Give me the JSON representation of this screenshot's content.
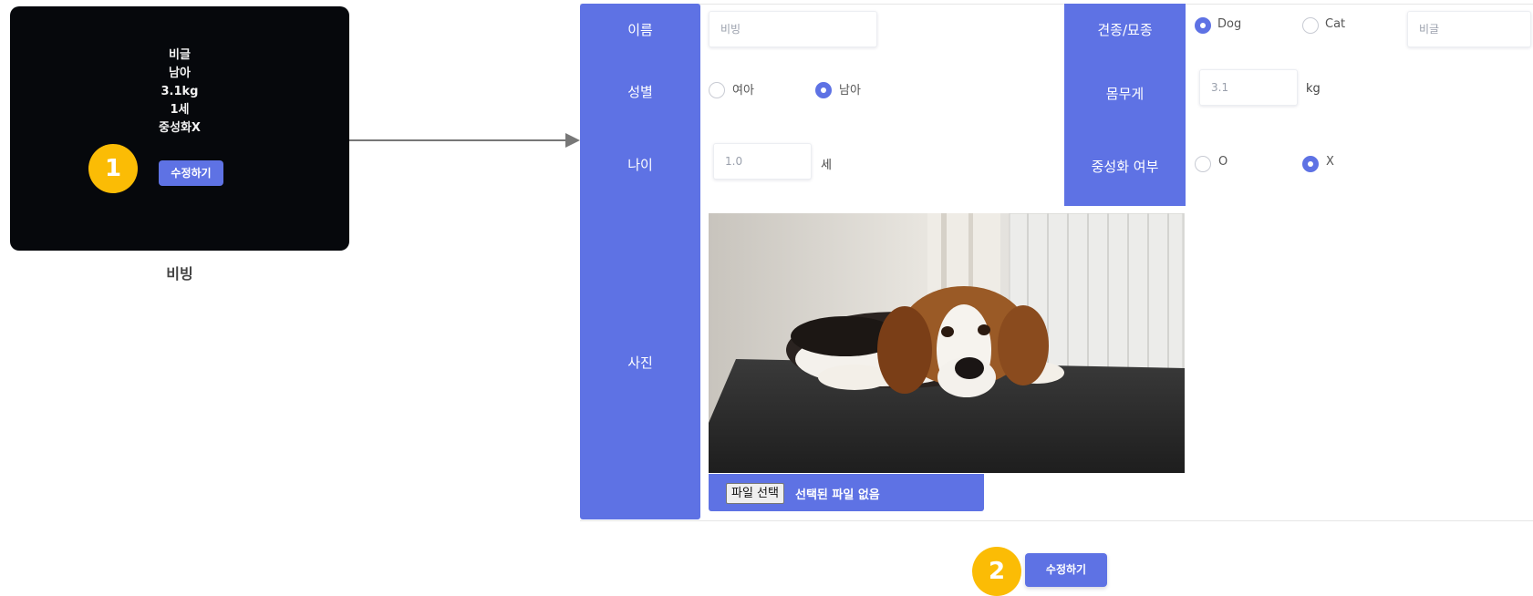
{
  "card": {
    "info_lines": [
      "비글",
      "남아",
      "3.1kg",
      "1세",
      "중성화X"
    ],
    "edit_label": "수정하기",
    "pet_name": "비빙"
  },
  "steps": [
    "1",
    "2"
  ],
  "form": {
    "labels": {
      "name": "이름",
      "gender": "성별",
      "age": "나이",
      "photo": "사진",
      "breed": "견종/묘종",
      "weight": "몸무게",
      "neutered": "중성화 여부"
    },
    "name_value": "비빙",
    "gender_options": [
      {
        "label": "여아",
        "checked": false
      },
      {
        "label": "남아",
        "checked": true
      }
    ],
    "age_value": "1.0",
    "age_unit": "세",
    "species_options": [
      {
        "label": "Dog",
        "checked": true
      },
      {
        "label": "Cat",
        "checked": false
      }
    ],
    "breed_value": "비글",
    "weight_value": "3.1",
    "weight_unit": "kg",
    "neutered_options": [
      {
        "label": "O",
        "checked": false
      },
      {
        "label": "X",
        "checked": true
      }
    ],
    "file_button": "파일 선택",
    "file_status": "선택된 파일 없음",
    "submit_label": "수정하기"
  },
  "colors": {
    "accent": "#5e72e4",
    "badge": "#fbbc05",
    "card_bg": "#06080c"
  }
}
